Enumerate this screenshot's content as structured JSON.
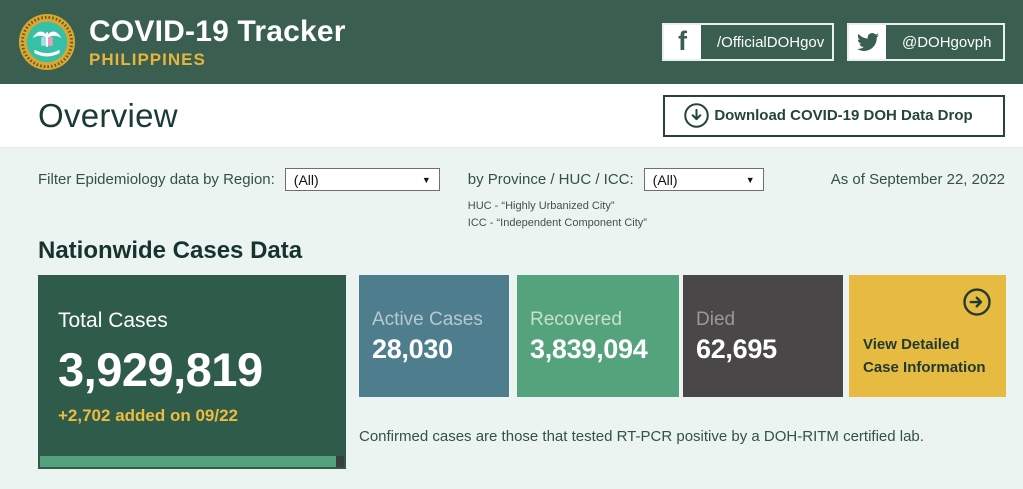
{
  "header": {
    "title": "COVID-19 Tracker",
    "subtitle": "PHILIPPINES",
    "facebook_handle": "/OfficialDOHgov",
    "twitter_handle": "@DOHgovph"
  },
  "overview": {
    "title": "Overview",
    "download_label": "Download COVID-19 DOH Data Drop"
  },
  "filters": {
    "region_label": "Filter Epidemiology data by Region:",
    "region_value": "(All)",
    "province_label": "by Province / HUC / ICC:",
    "province_value": "(All)",
    "huc_note": "HUC - “Highly Urbanized City”",
    "icc_note": "ICC - “Independent Component City”",
    "as_of": "As of September 22, 2022"
  },
  "section": {
    "title": "Nationwide Cases Data"
  },
  "cards": {
    "total": {
      "label": "Total Cases",
      "value": "3,929,819",
      "delta": "+2,702 added on 09/22"
    },
    "active": {
      "label": "Active Cases",
      "value": "28,030"
    },
    "recovered": {
      "label": "Recovered",
      "value": "3,839,094"
    },
    "died": {
      "label": "Died",
      "value": "62,695"
    },
    "view_detail": {
      "line1": "View Detailed",
      "line2": "Case Information"
    }
  },
  "footnote": "Confirmed cases are those that tested RT-PCR positive by a DOH-RITM certified lab.",
  "icons": {
    "logo": "doh-seal",
    "facebook": "facebook-f",
    "twitter": "twitter-bird",
    "download": "circle-arrow-down",
    "dropdown_caret": "caret-down",
    "view_detail": "circle-arrow-right"
  },
  "colors": {
    "header_green": "#3a5e4f",
    "total_card_green": "#2f5b4b",
    "active_blue": "#4e7e8e",
    "recovered_green": "#55a37c",
    "died_gray": "#494747",
    "accent_yellow": "#e7ba41",
    "panel_mint": "#ebf4f0",
    "dark_teal_text": "#1b3a34"
  }
}
